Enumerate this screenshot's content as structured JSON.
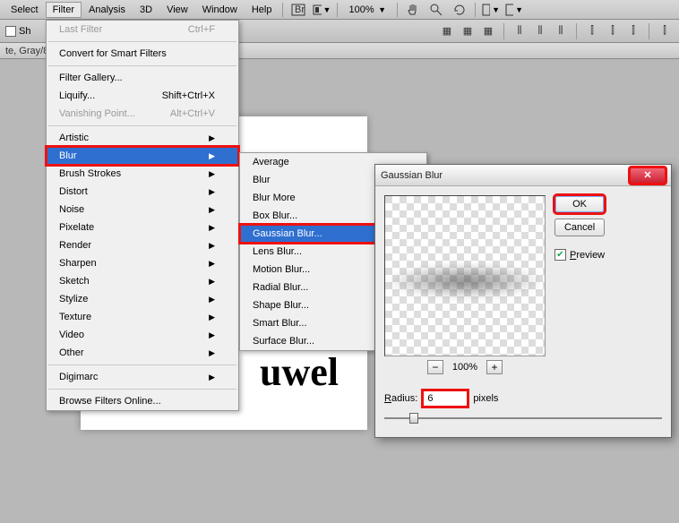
{
  "menubar": {
    "items": [
      "Select",
      "Filter",
      "Analysis",
      "3D",
      "View",
      "Window",
      "Help"
    ],
    "zoom": "100%"
  },
  "toolbar2": {
    "label": "Sh"
  },
  "statusbar": {
    "text": "te, Gray/8"
  },
  "canvas": {
    "text": "uwel"
  },
  "filterMenu": {
    "lastFilter": "Last Filter",
    "lastFilterKey": "Ctrl+F",
    "convert": "Convert for Smart Filters",
    "gallery": "Filter Gallery...",
    "liquify": "Liquify...",
    "liquifyKey": "Shift+Ctrl+X",
    "vanishing": "Vanishing Point...",
    "vanishingKey": "Alt+Ctrl+V",
    "groups": [
      "Artistic",
      "Blur",
      "Brush Strokes",
      "Distort",
      "Noise",
      "Pixelate",
      "Render",
      "Sharpen",
      "Sketch",
      "Stylize",
      "Texture",
      "Video",
      "Other"
    ],
    "digimarc": "Digimarc",
    "browse": "Browse Filters Online..."
  },
  "blurMenu": {
    "items": [
      "Average",
      "Blur",
      "Blur More",
      "Box Blur...",
      "Gaussian Blur...",
      "Lens Blur...",
      "Motion Blur...",
      "Radial Blur...",
      "Shape Blur...",
      "Smart Blur...",
      "Surface Blur..."
    ]
  },
  "dialog": {
    "title": "Gaussian Blur",
    "ok": "OK",
    "cancel": "Cancel",
    "preview": "Preview",
    "zoom": "100%",
    "radiusLabel": "Radius:",
    "radiusValue": "6",
    "radiusUnit": "pixels"
  }
}
